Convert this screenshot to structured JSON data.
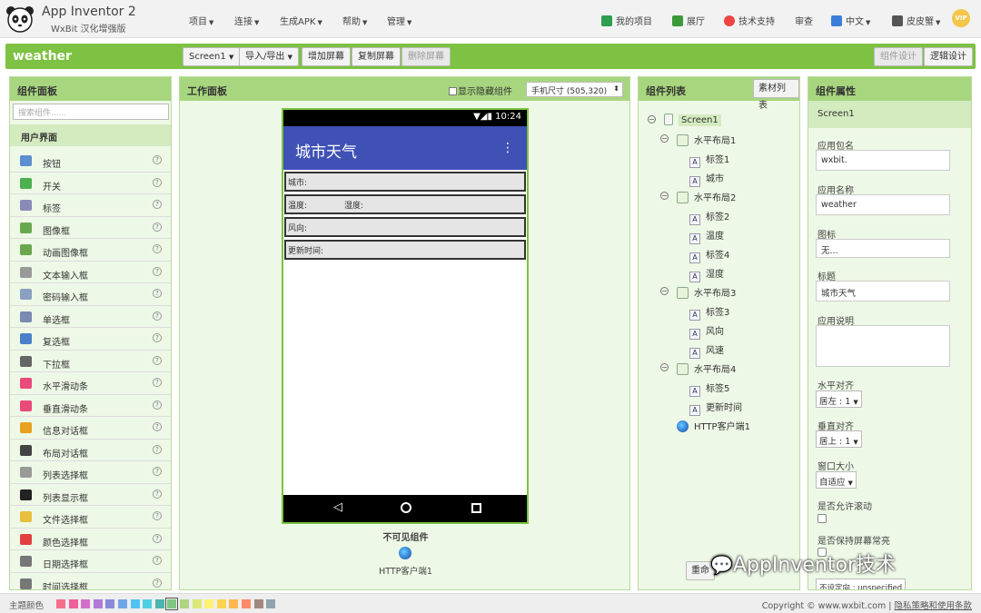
{
  "app": {
    "title": "App Inventor 2",
    "subtitle": "WxBit 汉化增强版"
  },
  "menu": [
    "项目",
    "连接",
    "生成APK",
    "帮助",
    "管理"
  ],
  "right_menu": {
    "my_projects": "我的项目",
    "gallery": "展厅",
    "support": "技术支持",
    "review": "审查",
    "lang": "中文",
    "user": "皮皮蟹",
    "vip": "VIP"
  },
  "toolbar": {
    "project": "weather",
    "screen": "Screen1",
    "import_export": "导入/导出",
    "add_screen": "增加屏幕",
    "copy_screen": "复制屏幕",
    "delete_screen": "删除屏幕",
    "designer": "组件设计",
    "blocks": "逻辑设计"
  },
  "palette": {
    "title": "组件面板",
    "search_placeholder": "搜索组件......",
    "category": "用户界面",
    "items": [
      {
        "label": "按钮",
        "icon": "button-icon",
        "color": "#5b8fd0"
      },
      {
        "label": "开关",
        "icon": "switch-icon",
        "color": "#4caf50"
      },
      {
        "label": "标签",
        "icon": "label-icon",
        "color": "#8a8ab8"
      },
      {
        "label": "图像框",
        "icon": "image-icon",
        "color": "#6aa84f"
      },
      {
        "label": "动画图像框",
        "icon": "animated-image-icon",
        "color": "#6aa84f"
      },
      {
        "label": "文本输入框",
        "icon": "textbox-icon",
        "color": "#999999"
      },
      {
        "label": "密码输入框",
        "icon": "password-icon",
        "color": "#8aa0c0"
      },
      {
        "label": "单选框",
        "icon": "radio-icon",
        "color": "#7a8ab0"
      },
      {
        "label": "复选框",
        "icon": "checkbox-icon",
        "color": "#4a80c8"
      },
      {
        "label": "下拉框",
        "icon": "spinner-icon",
        "color": "#666666"
      },
      {
        "label": "水平滑动条",
        "icon": "horizontal-slider-icon",
        "color": "#e84a7a"
      },
      {
        "label": "垂直滑动条",
        "icon": "vertical-slider-icon",
        "color": "#e84a7a"
      },
      {
        "label": "信息对话框",
        "icon": "notifier-icon",
        "color": "#e8a020"
      },
      {
        "label": "布局对话框",
        "icon": "layout-dialog-icon",
        "color": "#444444"
      },
      {
        "label": "列表选择框",
        "icon": "listpicker-icon",
        "color": "#999999"
      },
      {
        "label": "列表显示框",
        "icon": "listview-icon",
        "color": "#222222"
      },
      {
        "label": "文件选择框",
        "icon": "filepicker-icon",
        "color": "#e8c040"
      },
      {
        "label": "颜色选择框",
        "icon": "colorpicker-icon",
        "color": "#e04040"
      },
      {
        "label": "日期选择框",
        "icon": "datepicker-icon",
        "color": "#777777"
      },
      {
        "label": "时间选择框",
        "icon": "timepicker-icon",
        "color": "#777777"
      }
    ]
  },
  "viewer": {
    "title": "工作面板",
    "show_hidden": "显示隐藏组件",
    "size_select": "手机尺寸 (505,320)",
    "time": "10:24",
    "app_title": "城市天气",
    "rows": [
      {
        "a": "城市:",
        "b": ""
      },
      {
        "a": "温度:",
        "b": "湿度:"
      },
      {
        "a": "风向:",
        "b": ""
      },
      {
        "a": "更新时间:",
        "b": ""
      }
    ],
    "nonvisible_title": "不可见组件",
    "nonvisible_item": "HTTP客户端1"
  },
  "components": {
    "title": "组件列表",
    "media_button": "素材列表",
    "rename": "重命",
    "tree": [
      {
        "label": "Screen1",
        "type": "screen",
        "level": 0
      },
      {
        "label": "水平布局1",
        "type": "layout",
        "level": 1
      },
      {
        "label": "标签1",
        "type": "label",
        "level": 2
      },
      {
        "label": "城市",
        "type": "label",
        "level": 2
      },
      {
        "label": "水平布局2",
        "type": "layout",
        "level": 1
      },
      {
        "label": "标签2",
        "type": "label",
        "level": 2
      },
      {
        "label": "温度",
        "type": "label",
        "level": 2
      },
      {
        "label": "标签4",
        "type": "label",
        "level": 2
      },
      {
        "label": "湿度",
        "type": "label",
        "level": 2
      },
      {
        "label": "水平布局3",
        "type": "layout",
        "level": 1
      },
      {
        "label": "标签3",
        "type": "label",
        "level": 2
      },
      {
        "label": "风向",
        "type": "label",
        "level": 2
      },
      {
        "label": "风速",
        "type": "label",
        "level": 2
      },
      {
        "label": "水平布局4",
        "type": "layout",
        "level": 1
      },
      {
        "label": "标签5",
        "type": "label",
        "level": 2
      },
      {
        "label": "更新时间",
        "type": "label",
        "level": 2
      },
      {
        "label": "HTTP客户端1",
        "type": "web",
        "level": 1
      }
    ]
  },
  "properties": {
    "title": "组件属性",
    "component": "Screen1",
    "package_label": "应用包名",
    "package_value": "wxbit.",
    "appname_label": "应用名称",
    "appname_value": "weather",
    "icon_label": "图标",
    "icon_value": "无...",
    "title_label": "标题",
    "title_value": "城市天气",
    "about_label": "应用说明",
    "halign_label": "水平对齐",
    "halign_value": "居左 : 1",
    "valign_label": "垂直对齐",
    "valign_value": "居上 : 1",
    "size_label": "窗口大小",
    "size_value": "自适应",
    "scroll_label": "是否允许滚动",
    "screen_on_label": "是否保持屏幕常亮",
    "orientation_value": "不设定向 : unspecified"
  },
  "watermark": "AppInventor技术",
  "footer": {
    "theme_label": "主题颜色",
    "swatches": [
      "#f46f8a",
      "#ef5f9b",
      "#d46fc8",
      "#b17ad6",
      "#8a8ad8",
      "#6fa6e8",
      "#4fc3f0",
      "#4dd0e1",
      "#4db6ac",
      "#81c784",
      "#aed581",
      "#dce775",
      "#fff176",
      "#ffd54f",
      "#ffb74d",
      "#ff8a65",
      "#a1887f",
      "#90a4ae"
    ],
    "copyright": "Copyright © www.wxbit.com",
    "privacy": "隐私策略和使用条款"
  }
}
